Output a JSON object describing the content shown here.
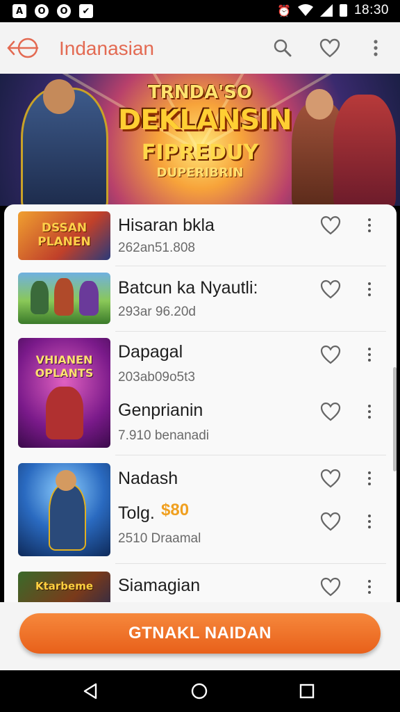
{
  "status_bar": {
    "time": "18:30",
    "notification_icons": [
      "A",
      "O",
      "O",
      "✔"
    ],
    "right_icons": [
      "alarm-icon",
      "wifi-icon",
      "signal-icon",
      "battery-icon"
    ]
  },
  "app_bar": {
    "title": "Indanasian",
    "icons": [
      "logo-icon",
      "search-icon",
      "heart-icon",
      "more-icon"
    ],
    "accent": "#e36a52"
  },
  "banner": {
    "line1": "TRNDA'SO",
    "line2": "DEKLANSIN",
    "line3": "FIPREDUY",
    "line4": "DUPERIBRIN"
  },
  "list": {
    "items": [
      {
        "title": "Hisaran bkla",
        "meta": "262an51.808",
        "thumb_text": "DSSAN PLANEN"
      },
      {
        "title": "Batcun ka Nyautli:",
        "meta": "293ar 96.20d",
        "thumb_text": ""
      },
      {
        "title": "Dapagal",
        "meta": "203ab09o5t3",
        "thumb_text": "VHIANEN OPLANTS"
      },
      {
        "title": "Genprianin",
        "meta": "7.910 benanadi",
        "thumb_text": ""
      },
      {
        "title": "Nadash",
        "meta": "",
        "thumb_text": ""
      },
      {
        "title": "Tolg.",
        "price": "$80",
        "meta": "2510 Draamal",
        "thumb_text": ""
      },
      {
        "title": "Siamagian",
        "meta": "",
        "thumb_text": "Ktarbeme"
      }
    ]
  },
  "cta": {
    "label": "GTNAKL NAIDAN",
    "color": "#e8601a"
  },
  "nav": {
    "icons": [
      "back-icon",
      "home-icon",
      "recents-icon"
    ]
  }
}
